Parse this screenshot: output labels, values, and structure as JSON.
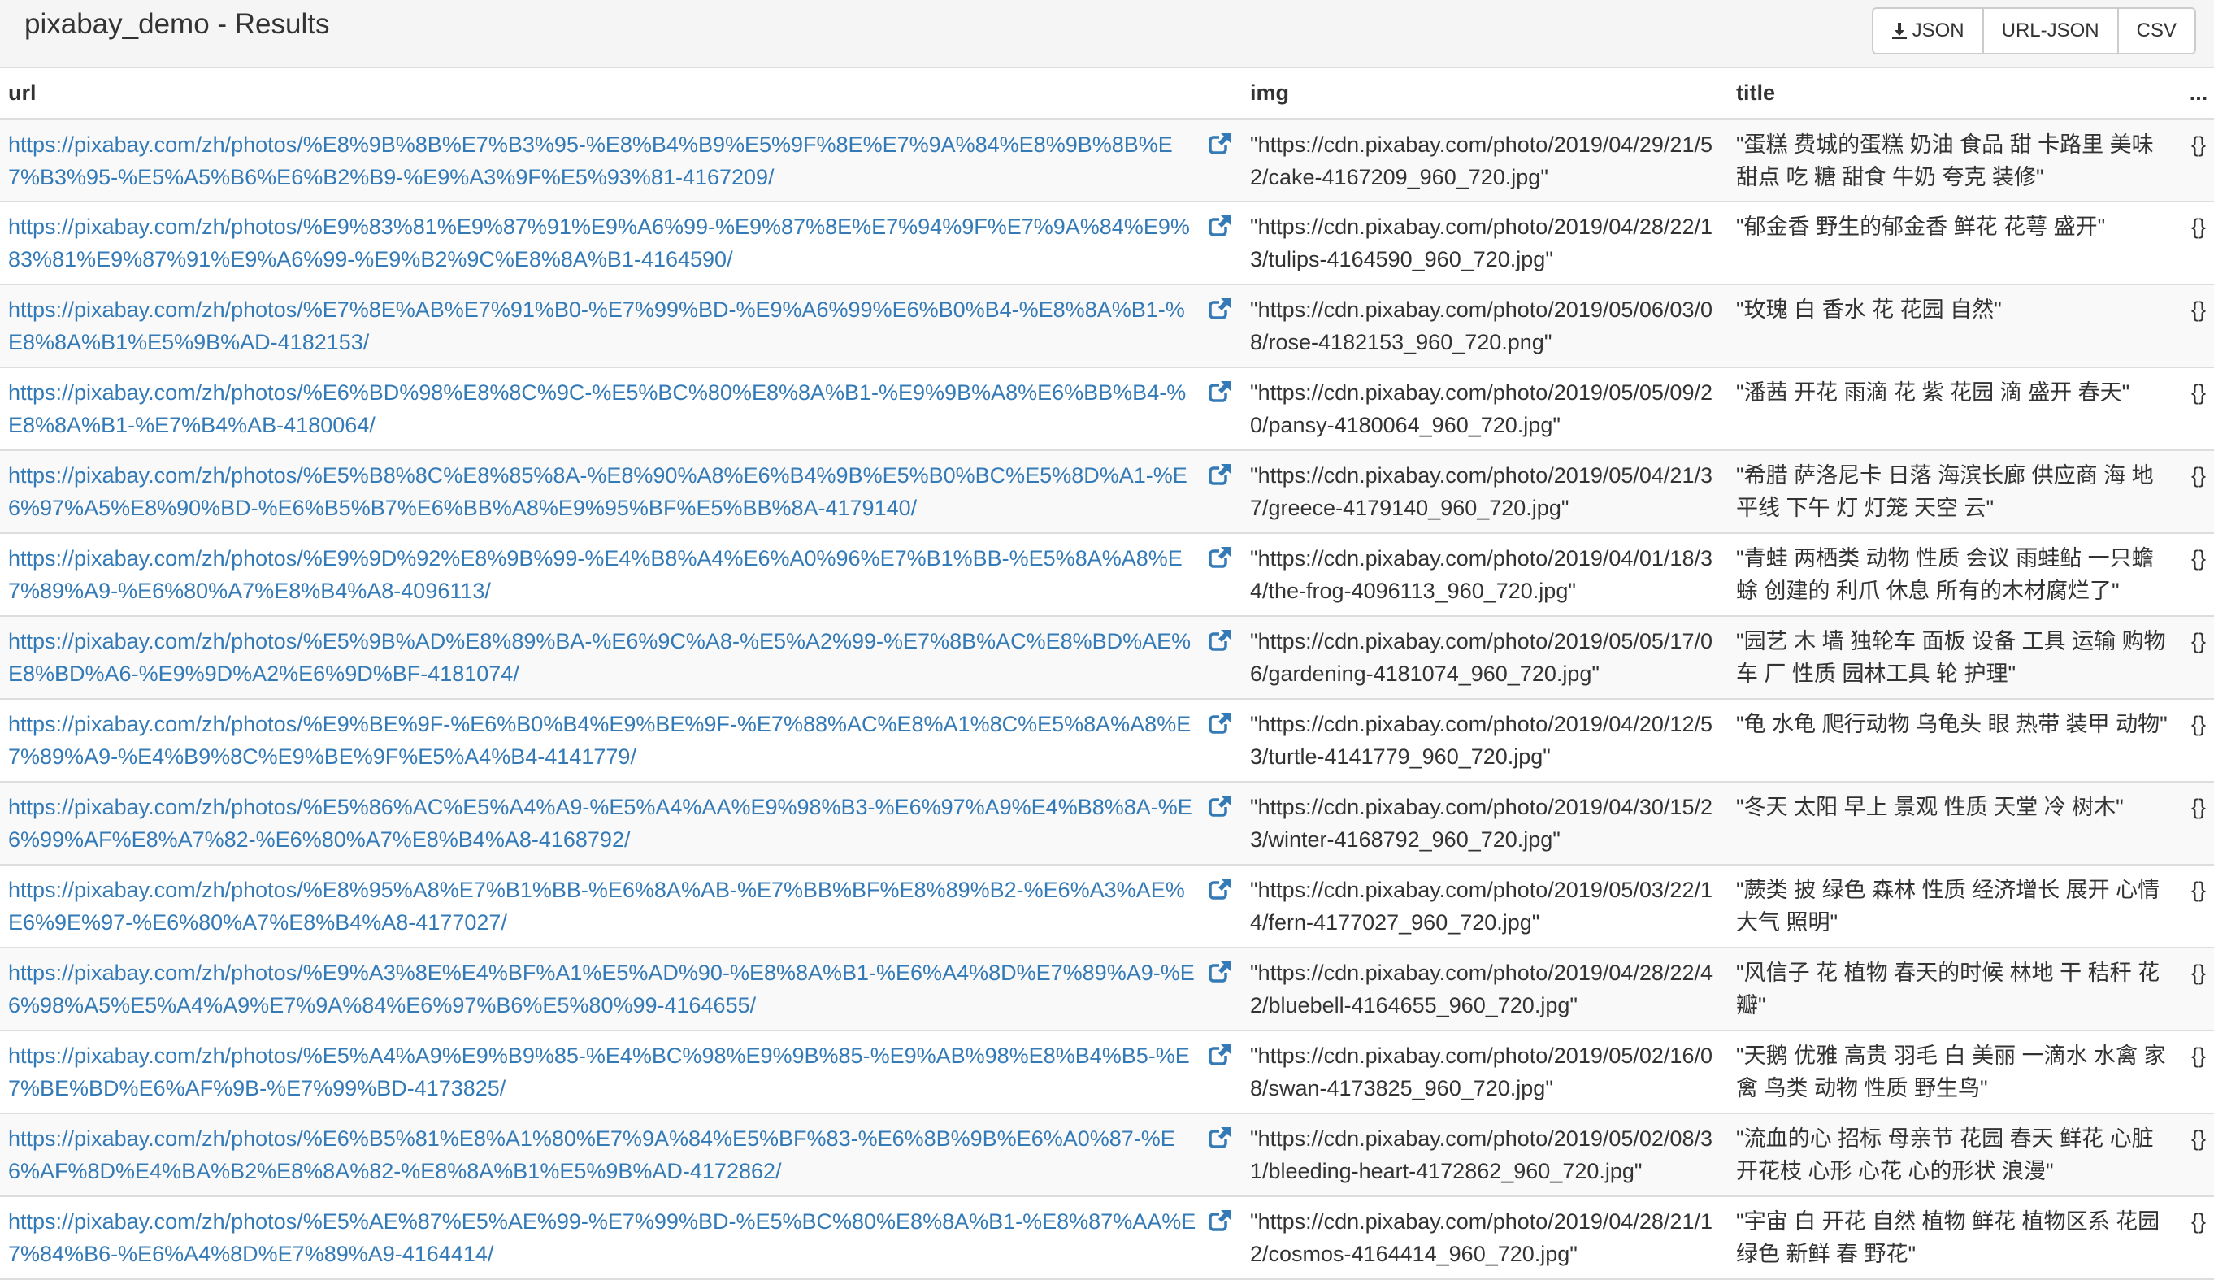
{
  "header": {
    "title": "pixabay_demo - Results",
    "export_buttons": [
      {
        "label": "JSON",
        "icon": "download-icon"
      },
      {
        "label": "URL-JSON"
      },
      {
        "label": "CSV"
      }
    ]
  },
  "table": {
    "columns": [
      "url",
      "img",
      "title",
      "..."
    ],
    "rows": [
      {
        "url": "https://pixabay.com/zh/photos/%E8%9B%8B%E7%B3%95-%E8%B4%B9%E5%9F%8E%E7%9A%84%E8%9B%8B%E7%B3%95-%E5%A5%B6%E6%B2%B9-%E9%A3%9F%E5%93%81-4167209/",
        "img": "\"https://cdn.pixabay.com/photo/2019/04/29/21/52/cake-4167209_960_720.jpg\"",
        "title": "\"蛋糕 费城的蛋糕 奶油 食品 甜 卡路里 美味 甜点 吃 糖 甜食 牛奶 夸克 装修\"",
        "extra": "{}"
      },
      {
        "url": "https://pixabay.com/zh/photos/%E9%83%81%E9%87%91%E9%A6%99-%E9%87%8E%E7%94%9F%E7%9A%84%E9%83%81%E9%87%91%E9%A6%99-%E9%B2%9C%E8%8A%B1-4164590/",
        "img": "\"https://cdn.pixabay.com/photo/2019/04/28/22/13/tulips-4164590_960_720.jpg\"",
        "title": "\"郁金香 野生的郁金香 鲜花 花萼 盛开\"",
        "extra": "{}"
      },
      {
        "url": "https://pixabay.com/zh/photos/%E7%8E%AB%E7%91%B0-%E7%99%BD-%E9%A6%99%E6%B0%B4-%E8%8A%B1-%E8%8A%B1%E5%9B%AD-4182153/",
        "img": "\"https://cdn.pixabay.com/photo/2019/05/06/03/08/rose-4182153_960_720.png\"",
        "title": "\"玫瑰 白 香水 花 花园 自然\"",
        "extra": "{}"
      },
      {
        "url": "https://pixabay.com/zh/photos/%E6%BD%98%E8%8C%9C-%E5%BC%80%E8%8A%B1-%E9%9B%A8%E6%BB%B4-%E8%8A%B1-%E7%B4%AB-4180064/",
        "img": "\"https://cdn.pixabay.com/photo/2019/05/05/09/20/pansy-4180064_960_720.jpg\"",
        "title": "\"潘茜 开花 雨滴 花 紫 花园 滴 盛开 春天\"",
        "extra": "{}"
      },
      {
        "url": "https://pixabay.com/zh/photos/%E5%B8%8C%E8%85%8A-%E8%90%A8%E6%B4%9B%E5%B0%BC%E5%8D%A1-%E6%97%A5%E8%90%BD-%E6%B5%B7%E6%BB%A8%E9%95%BF%E5%BB%8A-4179140/",
        "img": "\"https://cdn.pixabay.com/photo/2019/05/04/21/37/greece-4179140_960_720.jpg\"",
        "title": "\"希腊 萨洛尼卡 日落 海滨长廊 供应商 海 地平线 下午 灯 灯笼 天空 云\"",
        "extra": "{}"
      },
      {
        "url": "https://pixabay.com/zh/photos/%E9%9D%92%E8%9B%99-%E4%B8%A4%E6%A0%96%E7%B1%BB-%E5%8A%A8%E7%89%A9-%E6%80%A7%E8%B4%A8-4096113/",
        "img": "\"https://cdn.pixabay.com/photo/2019/04/01/18/34/the-frog-4096113_960_720.jpg\"",
        "title": "\"青蛙 两栖类 动物 性质 会议 雨蛙鲇 一只蟾蜍 创建的 利爪 休息 所有的木材腐烂了\"",
        "extra": "{}"
      },
      {
        "url": "https://pixabay.com/zh/photos/%E5%9B%AD%E8%89%BA-%E6%9C%A8-%E5%A2%99-%E7%8B%AC%E8%BD%AE%E8%BD%A6-%E9%9D%A2%E6%9D%BF-4181074/",
        "img": "\"https://cdn.pixabay.com/photo/2019/05/05/17/06/gardening-4181074_960_720.jpg\"",
        "title": "\"园艺 木 墙 独轮车 面板 设备 工具 运输 购物车 厂 性质 园林工具 轮 护理\"",
        "extra": "{}"
      },
      {
        "url": "https://pixabay.com/zh/photos/%E9%BE%9F-%E6%B0%B4%E9%BE%9F-%E7%88%AC%E8%A1%8C%E5%8A%A8%E7%89%A9-%E4%B9%8C%E9%BE%9F%E5%A4%B4-4141779/",
        "img": "\"https://cdn.pixabay.com/photo/2019/04/20/12/53/turtle-4141779_960_720.jpg\"",
        "title": "\"龟 水龟 爬行动物 乌龟头 眼 热带 装甲 动物\"",
        "extra": "{}"
      },
      {
        "url": "https://pixabay.com/zh/photos/%E5%86%AC%E5%A4%A9-%E5%A4%AA%E9%98%B3-%E6%97%A9%E4%B8%8A-%E6%99%AF%E8%A7%82-%E6%80%A7%E8%B4%A8-4168792/",
        "img": "\"https://cdn.pixabay.com/photo/2019/04/30/15/23/winter-4168792_960_720.jpg\"",
        "title": "\"冬天 太阳 早上 景观 性质 天堂 冷 树木\"",
        "extra": "{}"
      },
      {
        "url": "https://pixabay.com/zh/photos/%E8%95%A8%E7%B1%BB-%E6%8A%AB-%E7%BB%BF%E8%89%B2-%E6%A3%AE%E6%9E%97-%E6%80%A7%E8%B4%A8-4177027/",
        "img": "\"https://cdn.pixabay.com/photo/2019/05/03/22/14/fern-4177027_960_720.jpg\"",
        "title": "\"蕨类 披 绿色 森林 性质 经济增长 展开 心情 大气 照明\"",
        "extra": "{}"
      },
      {
        "url": "https://pixabay.com/zh/photos/%E9%A3%8E%E4%BF%A1%E5%AD%90-%E8%8A%B1-%E6%A4%8D%E7%89%A9-%E6%98%A5%E5%A4%A9%E7%9A%84%E6%97%B6%E5%80%99-4164655/",
        "img": "\"https://cdn.pixabay.com/photo/2019/04/28/22/42/bluebell-4164655_960_720.jpg\"",
        "title": "\"风信子 花 植物 春天的时候 林地 干 秸秆 花瓣\"",
        "extra": "{}"
      },
      {
        "url": "https://pixabay.com/zh/photos/%E5%A4%A9%E9%B9%85-%E4%BC%98%E9%9B%85-%E9%AB%98%E8%B4%B5-%E7%BE%BD%E6%AF%9B-%E7%99%BD-4173825/",
        "img": "\"https://cdn.pixabay.com/photo/2019/05/02/16/08/swan-4173825_960_720.jpg\"",
        "title": "\"天鹅 优雅 高贵 羽毛 白 美丽 一滴水 水禽 家禽 鸟类 动物 性质 野生鸟\"",
        "extra": "{}"
      },
      {
        "url": "https://pixabay.com/zh/photos/%E6%B5%81%E8%A1%80%E7%9A%84%E5%BF%83-%E6%8B%9B%E6%A0%87-%E6%AF%8D%E4%BA%B2%E8%8A%82-%E8%8A%B1%E5%9B%AD-4172862/",
        "img": "\"https://cdn.pixabay.com/photo/2019/05/02/08/31/bleeding-heart-4172862_960_720.jpg\"",
        "title": "\"流血的心 招标 母亲节 花园 春天 鲜花 心脏开花枝 心形 心花 心的形状 浪漫\"",
        "extra": "{}"
      },
      {
        "url": "https://pixabay.com/zh/photos/%E5%AE%87%E5%AE%99-%E7%99%BD-%E5%BC%80%E8%8A%B1-%E8%87%AA%E7%84%B6-%E6%A4%8D%E7%89%A9-4164414/",
        "img": "\"https://cdn.pixabay.com/photo/2019/04/28/21/12/cosmos-4164414_960_720.jpg\"",
        "title": "\"宇宙 白 开花 自然 植物 鲜花 植物区系 花园 绿色 新鲜 春 野花\"",
        "extra": "{}"
      }
    ]
  },
  "colors": {
    "link": "#337ab7",
    "text": "#333333",
    "border": "#dddddd",
    "header_bg": "#f5f5f5",
    "stripe": "#f9f9f9"
  }
}
